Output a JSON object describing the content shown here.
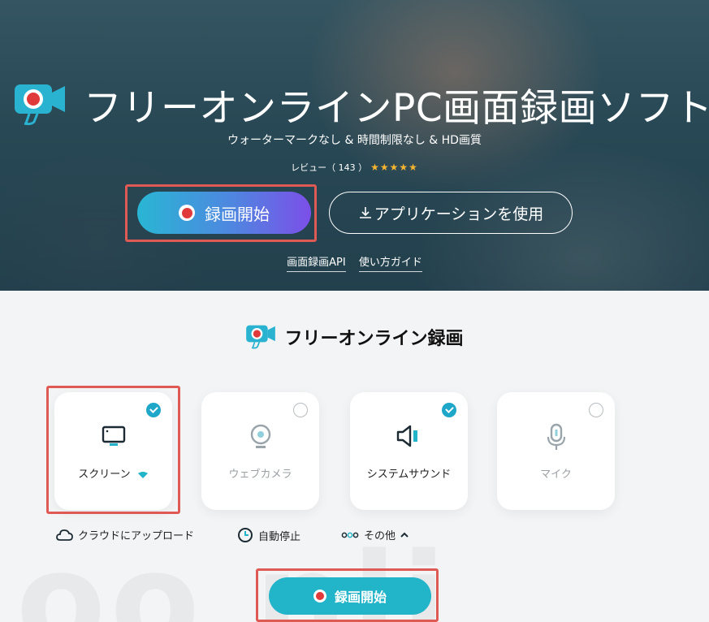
{
  "hero": {
    "title": "フリーオンラインPC画面録画ソフト",
    "subtitle": "ウォーターマークなし & 時間制限なし & HD画質",
    "review_label": "レビュー（ 143 ）",
    "stars": "★★★★★",
    "record_button": "録画開始",
    "app_button": "アプリケーションを使用",
    "links": [
      "画面録画API",
      "使い方ガイド"
    ]
  },
  "section": {
    "title": "フリーオンライン録画",
    "cards": [
      {
        "label": "スクリーン",
        "checked": true
      },
      {
        "label": "ウェブカメラ",
        "checked": false
      },
      {
        "label": "システムサウンド",
        "checked": true
      },
      {
        "label": "マイク",
        "checked": false
      }
    ],
    "options": [
      "クラウドにアップロード",
      "自動停止",
      "その他"
    ],
    "record_button": "録画開始"
  },
  "colors": {
    "accent": "#22b4c8",
    "highlight": "#e05a55",
    "record_red": "#e13a3a"
  }
}
